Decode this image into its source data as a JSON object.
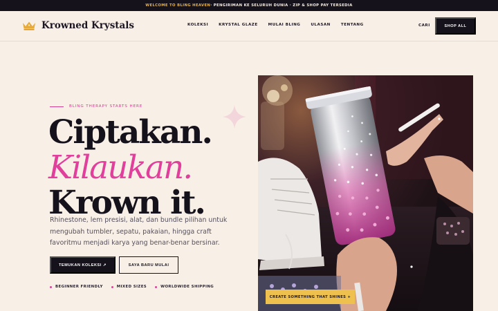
{
  "announcement": {
    "highlight": "WELCOME TO BLING HEAVEN",
    "rest": " · PENGIRIMAN KE SELURUH DUNIA · ZIP & SHOP PAY TERSEDIA"
  },
  "header": {
    "brand_name": "Krowned Krystals",
    "logo_icon": "crown-icon",
    "menu": [
      "KOLEKSI",
      "KRYSTAL GLAZE",
      "MULAI BLING",
      "ULASAN",
      "TENTANG"
    ],
    "search_label": "CARI",
    "shop_all_label": "SHOP ALL"
  },
  "hero": {
    "eyebrow": "BLING THERAPY STARTS HERE",
    "headline_line1": "Ciptakan.",
    "headline_line2": "Kilaukan.",
    "headline_line3": "Krown it.",
    "description": "Rhinestone, lem presisi, alat, dan bundle pilihan untuk mengubah tumbler, sepatu, pakaian, hingga craft favoritmu menjadi karya yang benar-benar bersinar.",
    "primary_cta": "TEMUKAN KOLEKSI ↗",
    "secondary_cta": "SAYA BARU MULAI",
    "features": [
      "BEGINNER FRIENDLY",
      "MIXED SIZES",
      "WORLDWIDE SHIPPING"
    ],
    "photo_badge": "CREATE SOMETHING THAT SHINES +"
  },
  "colors": {
    "accent_pink": "#e0409b",
    "dark": "#15121b",
    "gold": "#eec14f",
    "background": "#f8efe7"
  }
}
